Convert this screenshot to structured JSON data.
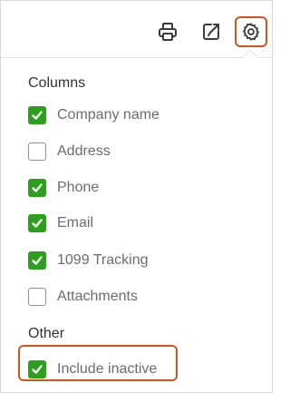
{
  "toolbar": {
    "icons": [
      "printer-icon",
      "export-icon",
      "gear-icon"
    ]
  },
  "columns_section": {
    "title": "Columns",
    "items": [
      {
        "label": "Company name",
        "checked": true
      },
      {
        "label": "Address",
        "checked": false
      },
      {
        "label": "Phone",
        "checked": true
      },
      {
        "label": "Email",
        "checked": true
      },
      {
        "label": "1099 Tracking",
        "checked": true
      },
      {
        "label": "Attachments",
        "checked": false
      }
    ]
  },
  "other_section": {
    "title": "Other",
    "items": [
      {
        "label": "Include inactive",
        "checked": true
      }
    ]
  },
  "colors": {
    "checked_green": "#2ca01c",
    "highlight_orange": "#d2541e",
    "label_gray": "#6b6c72"
  }
}
